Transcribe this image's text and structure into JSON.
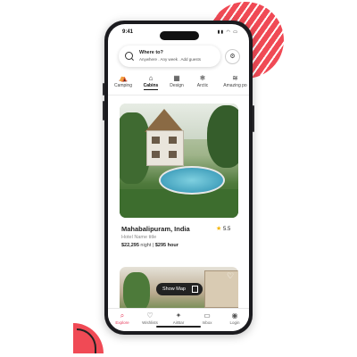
{
  "status": {
    "time": "9:41",
    "icons": "▮▮ ◠ ▭"
  },
  "search": {
    "title": "Where to?",
    "subtitle": "Anywhere . Any week . Add guests"
  },
  "categories": [
    {
      "label": "Camping",
      "icon": "tent-icon",
      "glyph": "⛺"
    },
    {
      "label": "Cabins",
      "icon": "cabin-icon",
      "glyph": "⌂"
    },
    {
      "label": "Design",
      "icon": "design-icon",
      "glyph": "▦"
    },
    {
      "label": "Arctic",
      "icon": "snowflake-icon",
      "glyph": "❄"
    },
    {
      "label": "Amazing po",
      "icon": "pool-icon",
      "glyph": "≋"
    }
  ],
  "active_category": "Cabins",
  "listing": {
    "title": "Mahabalipuram, India",
    "rating": "5.5",
    "subtitle": "Hotel Name title",
    "price_night": "$22,295",
    "night_label": "night",
    "separator": "|",
    "price_total": "$295 hour"
  },
  "show_map": {
    "label": "Show Map"
  },
  "tabs": [
    {
      "label": "Explore",
      "icon": "search-icon",
      "glyph": "⌕"
    },
    {
      "label": "Wishlists",
      "icon": "heart-icon",
      "glyph": "♡"
    },
    {
      "label": "AirBar",
      "icon": "airbar-icon",
      "glyph": "✦"
    },
    {
      "label": "Inbox",
      "icon": "inbox-icon",
      "glyph": "▭"
    },
    {
      "label": "Login",
      "icon": "profile-icon",
      "glyph": "◉"
    }
  ],
  "colors": {
    "accent": "#e6395a",
    "deco": "#f04a55",
    "star": "#f4b400"
  }
}
